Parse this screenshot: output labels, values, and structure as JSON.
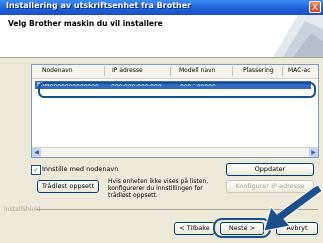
{
  "window": {
    "title": "Installering av utskriftsenhet fra Brother",
    "close_label": "X"
  },
  "header": {
    "subtitle": "Velg Brother maskin du vil installere"
  },
  "listview": {
    "columns": [
      "Nodenavn",
      "IP adresse",
      "Modell navn",
      "Plassering",
      "MAC-ac"
    ],
    "rows": [
      [
        "BRWXXXXXXXXXXXXX",
        "XXX.XXX.XXX.XXX",
        "XXX - XXXXX",
        "",
        ""
      ]
    ]
  },
  "options": {
    "show_node_name_label": "Innstille med nodenavn",
    "show_node_name_checked": true
  },
  "buttons": {
    "wireless_setup": "Trådløst oppsett",
    "refresh": "Oppdater",
    "configure_ip": "Konfigurer IP-adresse",
    "back": "< Tilbake",
    "next": "Neste >",
    "cancel": "Avbryt"
  },
  "help_text": "Hvis enheten ikke vises på listen, konfigurerer du innstillingen for trådløst oppsett.",
  "footer": {
    "brand": "InstallShield"
  },
  "colors": {
    "titlebar": "#1f5fd8",
    "selection": "#316ac5",
    "callout": "#1b4f8c"
  }
}
